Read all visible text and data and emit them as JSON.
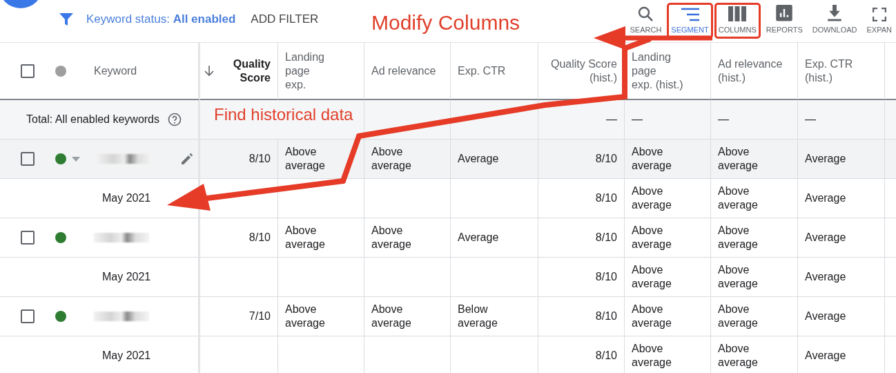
{
  "toolbar": {
    "filter_text": "Keyword status: **All enabled**",
    "add_filter": "ADD FILTER",
    "tools": [
      {
        "kind": "search",
        "label": "SEARCH",
        "selected": false,
        "highlighted": false
      },
      {
        "kind": "segment",
        "label": "SEGMENT",
        "selected": true,
        "highlighted": true
      },
      {
        "kind": "columns",
        "label": "COLUMNS",
        "selected": false,
        "highlighted": true
      },
      {
        "kind": "reports",
        "label": "REPORTS",
        "selected": false,
        "highlighted": false
      },
      {
        "kind": "download",
        "label": "DOWNLOAD",
        "selected": false,
        "highlighted": false
      },
      {
        "kind": "expand",
        "label": "EXPAN",
        "selected": false,
        "highlighted": false
      }
    ]
  },
  "table": {
    "keyword_header": "Keyword",
    "all_checked": false,
    "columns": [
      {
        "label": "Quality\nScore",
        "sorted": true,
        "numeric": true
      },
      {
        "label": "Landing page\nexp.",
        "sorted": false,
        "numeric": false
      },
      {
        "label": "Ad relevance",
        "sorted": false,
        "numeric": false
      },
      {
        "label": "Exp. CTR",
        "sorted": false,
        "numeric": false
      },
      {
        "label": "Quality Score\n(hist.)",
        "sorted": false,
        "numeric": true
      },
      {
        "label": "Landing page\nexp. (hist.)",
        "sorted": false,
        "numeric": false
      },
      {
        "label": "Ad relevance\n(hist.)",
        "sorted": false,
        "numeric": false
      },
      {
        "label": "Exp. CTR\n(hist.)",
        "sorted": false,
        "numeric": false
      }
    ],
    "total": {
      "label": "Total: All enabled keywords",
      "historical": [
        "—",
        "—",
        "—",
        "—"
      ]
    },
    "rows": [
      {
        "kind": "keyword",
        "checked": false,
        "color": "#2e7d32",
        "hovered": true,
        "current": [
          "8/10",
          "Above average",
          "Above average",
          "Average"
        ],
        "historical": [
          "8/10",
          "Above average",
          "Above average",
          "Average"
        ]
      },
      {
        "kind": "segment",
        "label": "May 2021",
        "historical": [
          "8/10",
          "Above average",
          "Above average",
          "Average"
        ]
      },
      {
        "kind": "keyword",
        "checked": false,
        "color": "#2e7d32",
        "hovered": false,
        "current": [
          "8/10",
          "Above average",
          "Above average",
          "Average"
        ],
        "historical": [
          "8/10",
          "Above average",
          "Above average",
          "Average"
        ]
      },
      {
        "kind": "segment",
        "label": "May 2021",
        "historical": [
          "8/10",
          "Above average",
          "Above average",
          "Average"
        ]
      },
      {
        "kind": "keyword",
        "checked": false,
        "color": "#2e7d32",
        "hovered": false,
        "current": [
          "7/10",
          "Above average",
          "Above average",
          "Below average"
        ],
        "historical": [
          "8/10",
          "Above average",
          "Above average",
          "Average"
        ]
      },
      {
        "kind": "segment",
        "label": "May 2021",
        "historical": [
          "8/10",
          "Above average",
          "Above average",
          "Average"
        ]
      }
    ]
  },
  "annotations": [
    {
      "kind": "columns_note",
      "text": "Modify Columns"
    },
    {
      "kind": "history_note",
      "text": "Find historical data"
    }
  ]
}
